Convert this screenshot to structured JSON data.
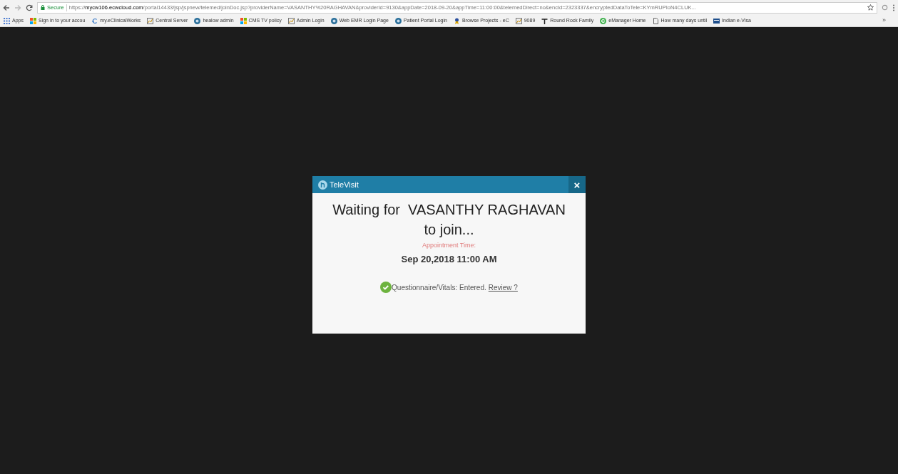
{
  "toolbar": {
    "secure_label": "Secure",
    "url_scheme": "https://",
    "url_host": "mycw106.ecwcloud.com",
    "url_path": "/portal14433/jsp/jspnew/telemed/joinDoc.jsp?providerName=VASANTHY%20RAGHAVAN&providerId=9130&appDate=2018-09-20&appTime=11:00:00&telemedDirect=no&encId=2323337&encryptedDataToTele=KYmRUPIoN4CLUK..."
  },
  "bookmarks": [
    {
      "label": "Apps",
      "kind": "apps"
    },
    {
      "label": "Sign in to your accou",
      "kind": "tiles"
    },
    {
      "label": "my.eClinicalWorks",
      "kind": "ec"
    },
    {
      "label": "Central Server",
      "kind": "chart"
    },
    {
      "label": "healow admin",
      "kind": "circle"
    },
    {
      "label": "CMS TV policy",
      "kind": "tiles"
    },
    {
      "label": "Admin Login",
      "kind": "chart"
    },
    {
      "label": "Web EMR Login Page",
      "kind": "circle"
    },
    {
      "label": "Patient Portal Login",
      "kind": "circle"
    },
    {
      "label": "Browse Projects - eC",
      "kind": "award"
    },
    {
      "label": "9089",
      "kind": "chart"
    },
    {
      "label": "Round Rock Family",
      "kind": "pin"
    },
    {
      "label": "eManager Home",
      "kind": "e"
    },
    {
      "label": "How many days until",
      "kind": "page"
    },
    {
      "label": "Indian e-Visa",
      "kind": "card"
    }
  ],
  "bookmarks_more": "»",
  "dialog": {
    "title": "TeleVisit",
    "close": "×",
    "heading_line_1": "Waiting for  VASANTHY RAGHAVAN",
    "heading_line_2": "to join...",
    "appointment_label": "Appointment Time:",
    "appointment_time": "Sep 20,2018 11:00 AM",
    "status_text": "Questionnaire/Vitals: Entered.",
    "review_link": "Review ?"
  }
}
